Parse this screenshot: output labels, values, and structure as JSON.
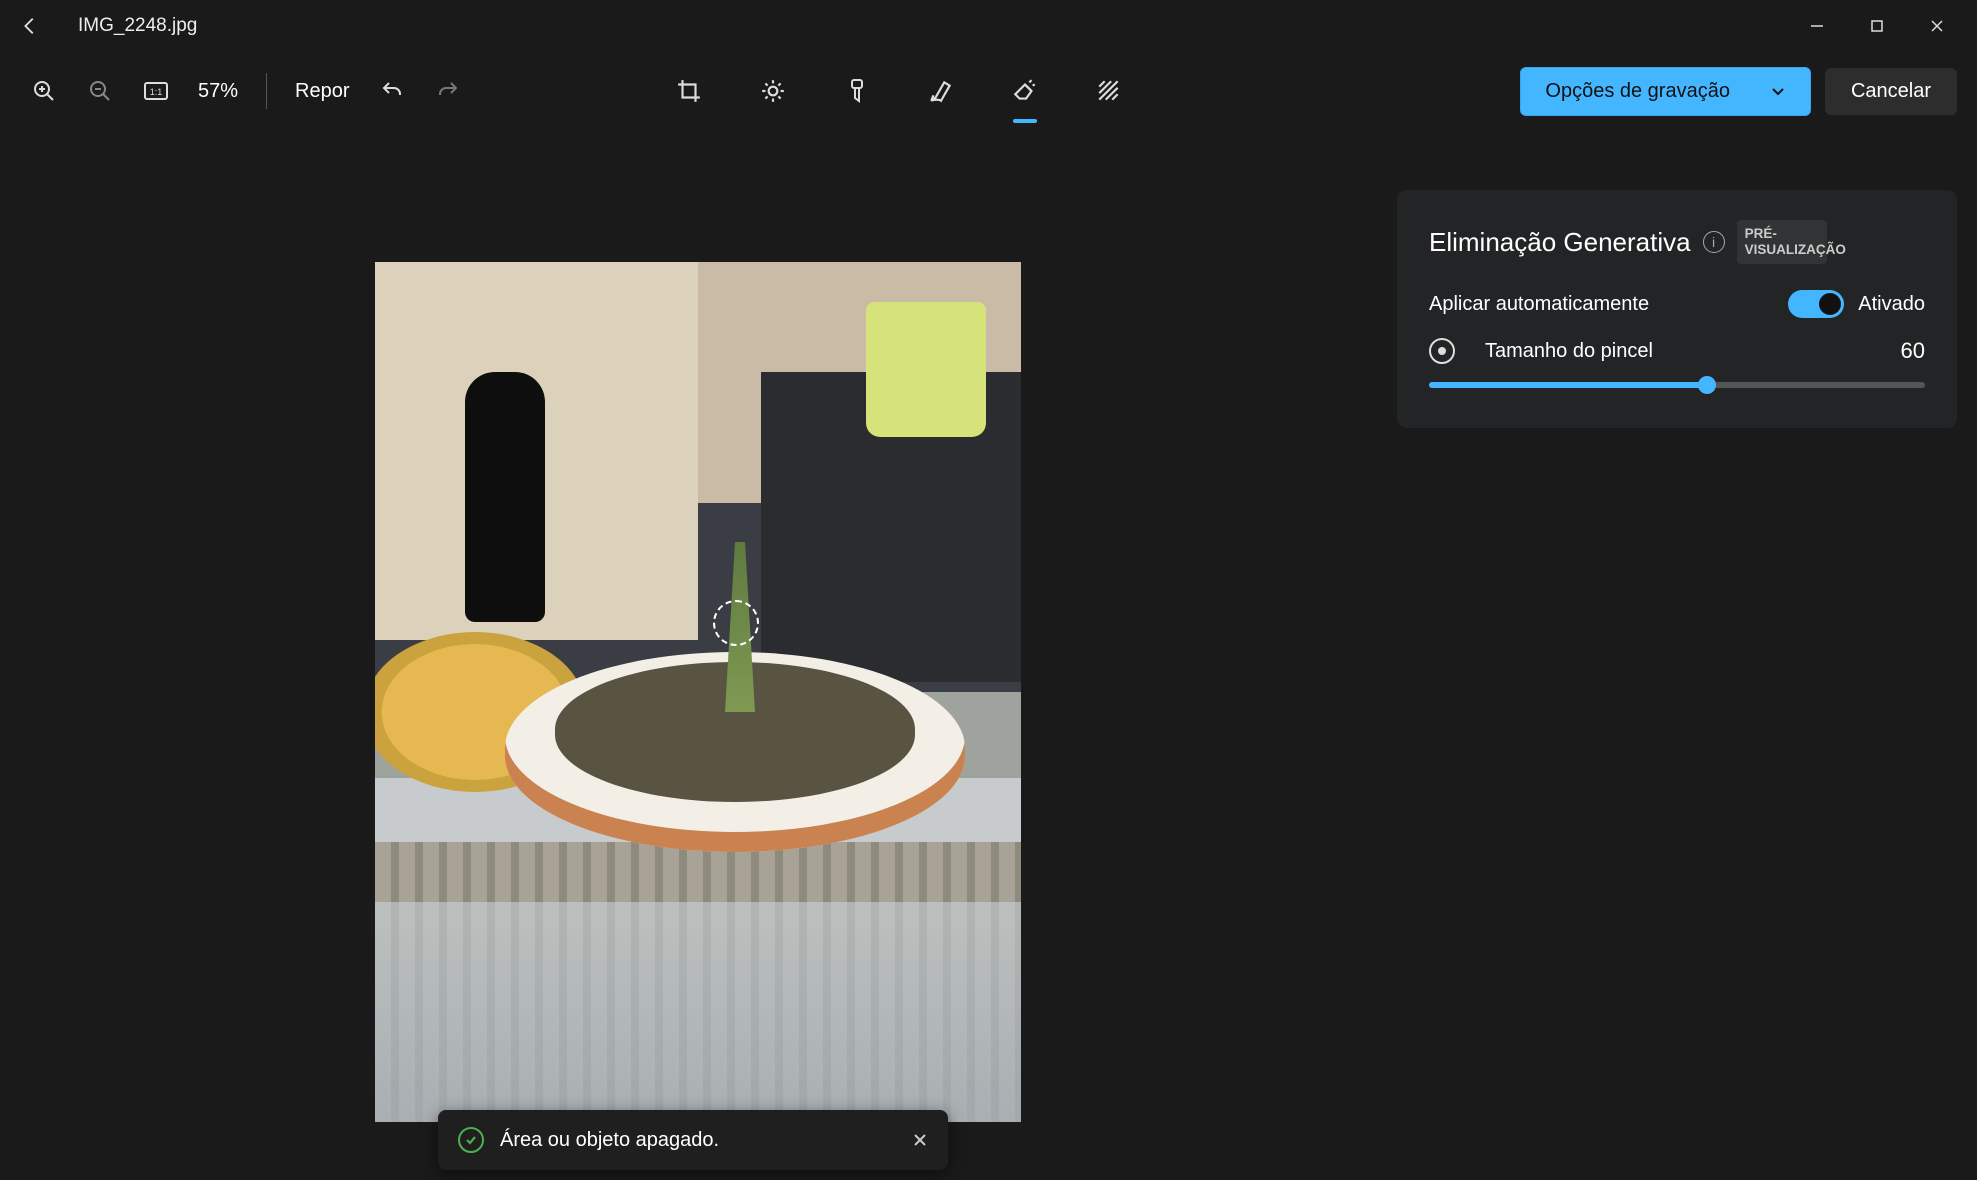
{
  "titlebar": {
    "filename": "IMG_2248.jpg"
  },
  "toolbar": {
    "zoom_percent": "57%",
    "reset_label": "Repor",
    "save_options_label": "Opções de gravação",
    "cancel_label": "Cancelar"
  },
  "tools": {
    "crop": "crop",
    "adjust": "adjustment",
    "filter": "filter",
    "markup": "markup",
    "erase": "erase",
    "background": "background"
  },
  "panel": {
    "title": "Eliminação Generativa",
    "badge": "PRÉ-VISUALIZAÇÃO",
    "auto_apply_label": "Aplicar automaticamente",
    "auto_apply_state": "Ativado",
    "brush_size_label": "Tamanho do pincel",
    "brush_size_value": "60"
  },
  "toast": {
    "message": "Área ou objeto apagado."
  },
  "colors": {
    "accent": "#43b6ff"
  }
}
